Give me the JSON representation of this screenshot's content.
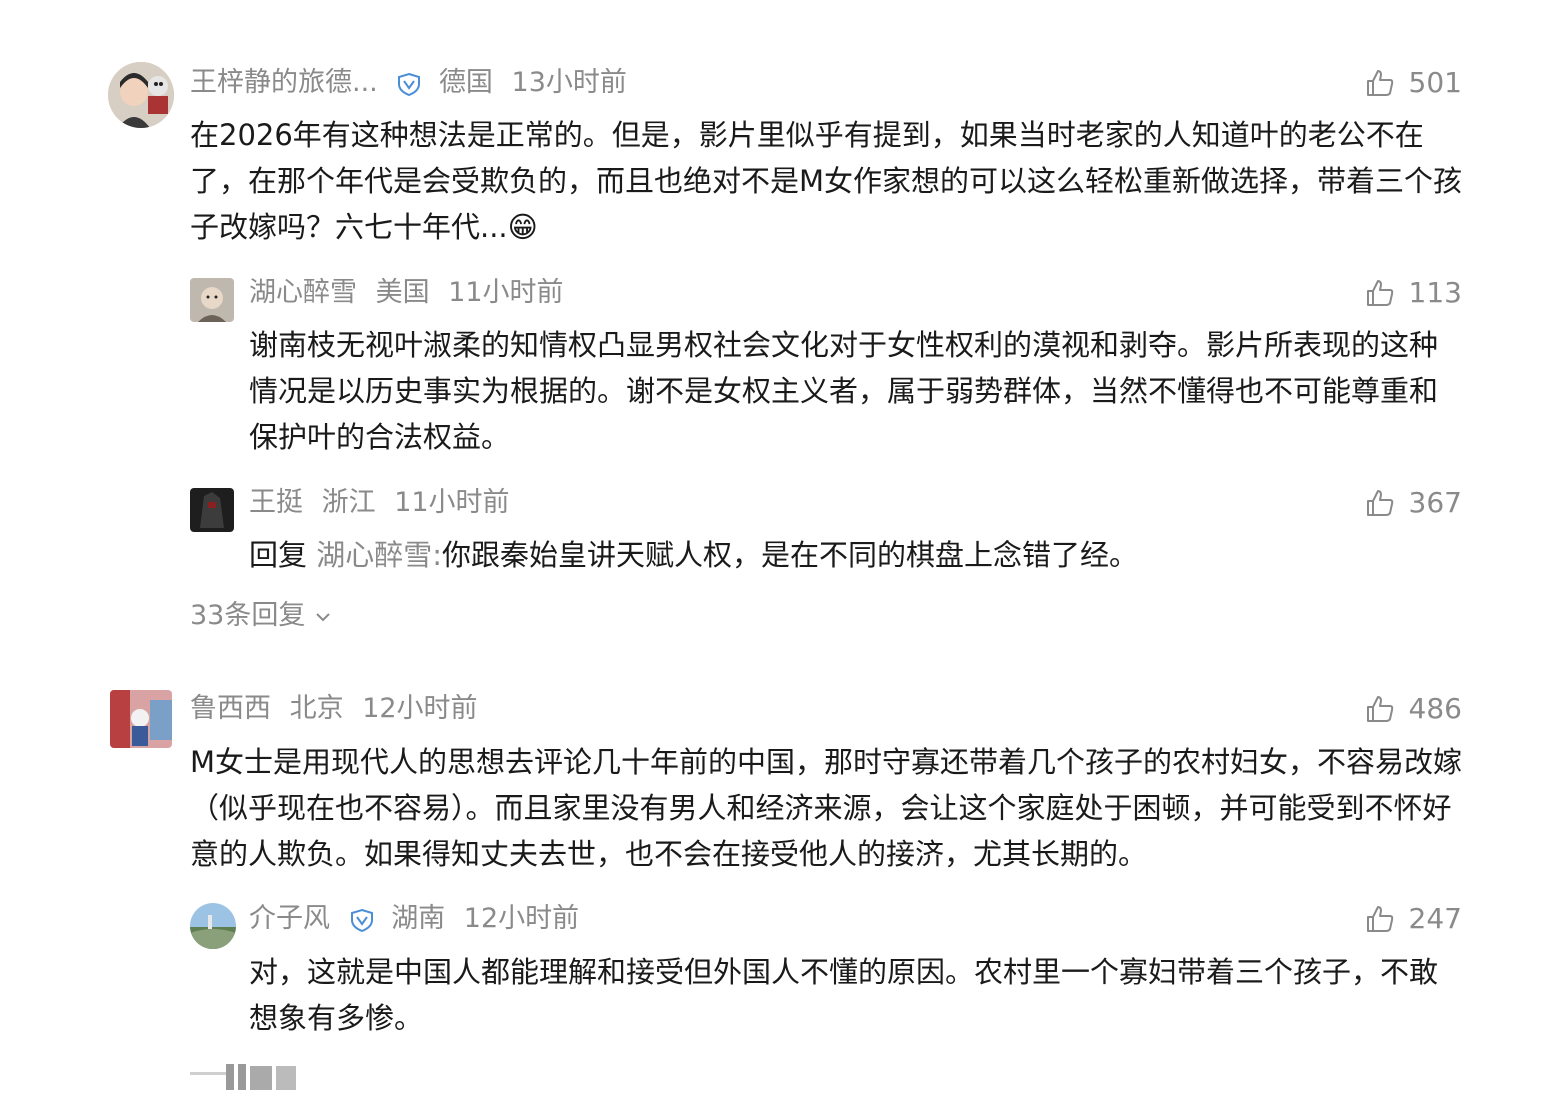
{
  "comments": [
    {
      "name": "王梓静的旅德...",
      "location": "德国",
      "time": "13小时前",
      "likes": "501",
      "text": "在2026年有这种想法是正常的。但是，影片里似乎有提到，如果当时老家的人知道叶的老公不在了，在那个年代是会受欺负的，而且也绝对不是M女作家想的可以这么轻松重新做选择，带着三个孩子改嫁吗？六七十年代...😁",
      "replies": [
        {
          "name": "湖心醉雪",
          "location": "美国",
          "time": "11小时前",
          "likes": "113",
          "text": "谢南枝无视叶淑柔的知情权凸显男权社会文化对于女性权利的漠视和剥夺。影片所表现的这种情况是以历史事实为根据的。谢不是女权主义者，属于弱势群体，当然不懂得也不可能尊重和保护叶的合法权益。"
        },
        {
          "name": "王挺",
          "location": "浙江",
          "time": "11小时前",
          "likes": "367",
          "reply_prefix": "回复",
          "reply_target": "湖心醉雪:",
          "text": "你跟秦始皇讲天赋人权，是在不同的棋盘上念错了经。"
        }
      ],
      "more_replies": "33条回复"
    },
    {
      "name": "鲁西西",
      "location": "北京",
      "time": "12小时前",
      "likes": "486",
      "text": "M女士是用现代人的思想去评论几十年前的中国，那时守寡还带着几个孩子的农村妇女，不容易改嫁（似乎现在也不容易）。而且家里没有男人和经济来源，会让这个家庭处于困顿，并可能受到不怀好意的人欺负。如果得知丈夫去世，也不会在接受他人的接济，尤其长期的。",
      "replies": [
        {
          "name": "介子风",
          "location": "湖南",
          "time": "12小时前",
          "likes": "247",
          "text": "对，这就是中国人都能理解和接受但外国人不懂的原因。农村里一个寡妇带着三个孩子，不敢想象有多惨。"
        }
      ]
    }
  ],
  "colors": {
    "meta": "#8a8a8a",
    "text": "#1a1a1a",
    "badge": "#4a8fd6"
  }
}
